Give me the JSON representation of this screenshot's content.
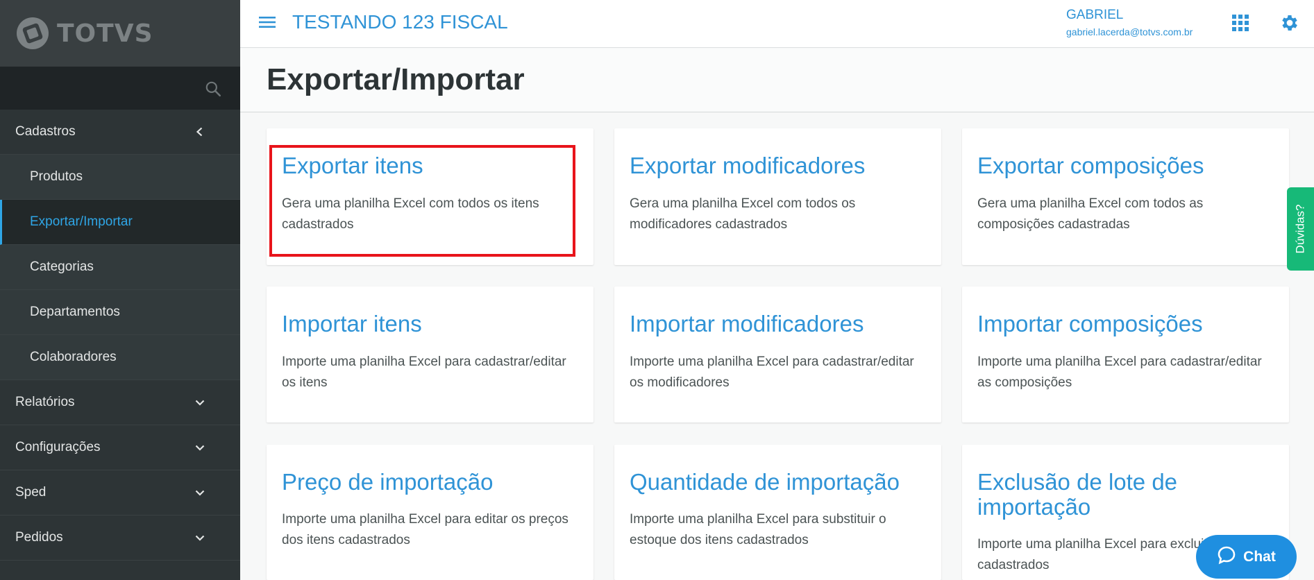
{
  "brand": {
    "logo_text": "TOTVS"
  },
  "header": {
    "app_title": "TESTANDO 123 FISCAL",
    "user_name": "GABRIEL",
    "user_email": "gabriel.lacerda@totvs.com.br"
  },
  "sidebar": {
    "groups": [
      {
        "label": "Cadastros",
        "expanded": true
      },
      {
        "label": "Relatórios"
      },
      {
        "label": "Configurações"
      },
      {
        "label": "Sped"
      },
      {
        "label": "Pedidos"
      }
    ],
    "cadastros_items": [
      {
        "label": "Produtos"
      },
      {
        "label": "Exportar/Importar",
        "active": true
      },
      {
        "label": "Categorias"
      },
      {
        "label": "Departamentos"
      },
      {
        "label": "Colaboradores"
      }
    ]
  },
  "page": {
    "title": "Exportar/Importar"
  },
  "cards": [
    {
      "title": "Exportar itens",
      "description": "Gera uma planilha Excel com todos os itens cadastrados"
    },
    {
      "title": "Exportar modificadores",
      "description": "Gera uma planilha Excel com todos os modificadores cadastrados"
    },
    {
      "title": "Exportar composições",
      "description": "Gera uma planilha Excel com todos as composições cadastradas"
    },
    {
      "title": "Importar itens",
      "description": "Importe uma planilha Excel para cadastrar/editar os itens"
    },
    {
      "title": "Importar modificadores",
      "description": "Importe uma planilha Excel para cadastrar/editar os modificadores"
    },
    {
      "title": "Importar composições",
      "description": "Importe uma planilha Excel para cadastrar/editar as composições"
    },
    {
      "title": "Preço de importação",
      "description": "Importe uma planilha Excel para editar os preços dos itens cadastrados"
    },
    {
      "title": "Quantidade de importação",
      "description": "Importe uma planilha Excel para substituir o estoque dos itens cadastrados"
    },
    {
      "title": "Exclusão de lote de importação",
      "description": "Importe uma planilha Excel para excluir itens cadastrados"
    }
  ],
  "help_tab": {
    "label": "Dúvidas?"
  },
  "chat": {
    "label": "Chat"
  },
  "colors": {
    "accent": "#2f93d6",
    "sidebar_bg": "#2d3436",
    "help_tab": "#17b978",
    "chat": "#1f8fe0",
    "highlight": "#e8141b"
  }
}
